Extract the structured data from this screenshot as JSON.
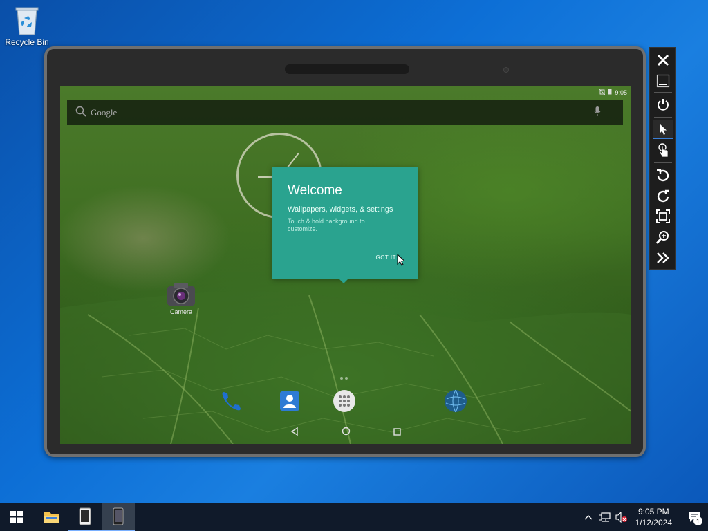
{
  "desktop": {
    "recycle_bin_label": "Recycle Bin"
  },
  "android": {
    "status_time": "9:05",
    "search_placeholder": "Google",
    "welcome": {
      "title": "Welcome",
      "subtitle": "Wallpapers, widgets, & settings",
      "description": "Touch & hold background to customize.",
      "got_it": "GOT IT"
    },
    "camera_app_label": "Camera",
    "nav": [
      "back",
      "home",
      "recents"
    ]
  },
  "emulator_toolbar": {
    "buttons": [
      "close",
      "minimize",
      "power",
      "select",
      "touch",
      "rotate-left",
      "rotate-right",
      "fit-to-screen",
      "zoom",
      "more"
    ]
  },
  "taskbar": {
    "clock_time": "9:05 PM",
    "clock_date": "1/12/2024",
    "notification_count": "1"
  },
  "colors": {
    "welcome_card": "#2aa38f",
    "desktop_blue": "#0d6fd6",
    "taskbar": "#101a2a"
  }
}
